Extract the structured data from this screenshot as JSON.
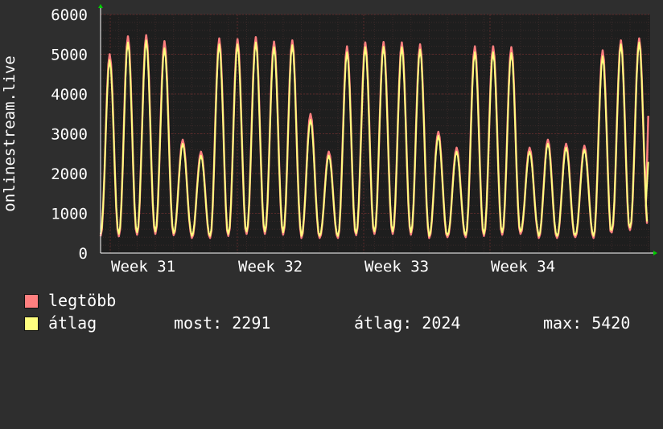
{
  "chart_data": {
    "type": "line",
    "ylabel": "onlinestream.live",
    "yticks": [
      0,
      1000,
      2000,
      3000,
      4000,
      5000,
      6000
    ],
    "ylim": [
      0,
      6000
    ],
    "xlabels": [
      "Week 31",
      "Week 32",
      "Week 33",
      "Week 34"
    ],
    "grid": true,
    "series": [
      {
        "name": "legtöbb",
        "color": "#ff7f7f",
        "peaks": [
          5000,
          5450,
          5480,
          5330,
          2850,
          2550,
          5400,
          5380,
          5430,
          5320,
          5350,
          3500,
          2550,
          5200,
          5300,
          5310,
          5300,
          5250,
          3050,
          2650,
          5200,
          5200,
          5180,
          2650,
          2850,
          2750,
          2700,
          5100,
          5350,
          5400
        ],
        "troughs": [
          420,
          420,
          460,
          480,
          450,
          380,
          380,
          430,
          480,
          480,
          460,
          380,
          380,
          380,
          450,
          480,
          480,
          460,
          380,
          400,
          400,
          430,
          460,
          480,
          380,
          380,
          400,
          380,
          520,
          580
        ],
        "last": 3450
      },
      {
        "name": "átlag",
        "color": "#ffff7f",
        "peaks": [
          4850,
          5300,
          5350,
          5150,
          2750,
          2450,
          5250,
          5250,
          5300,
          5180,
          5230,
          3350,
          2450,
          5050,
          5180,
          5190,
          5180,
          5120,
          2950,
          2550,
          5050,
          5050,
          5030,
          2550,
          2750,
          2650,
          2600,
          4950,
          5250,
          5300
        ],
        "troughs": [
          480,
          480,
          520,
          540,
          500,
          430,
          430,
          480,
          540,
          540,
          520,
          430,
          430,
          430,
          500,
          540,
          540,
          520,
          430,
          450,
          450,
          480,
          520,
          540,
          430,
          430,
          450,
          430,
          580,
          640
        ],
        "last": 2291
      }
    ]
  },
  "legend": [
    {
      "label": "legtöbb",
      "color": "#ff7f7f"
    },
    {
      "label": "átlag",
      "color": "#ffff7f"
    }
  ],
  "stats": {
    "now": "most: 2291",
    "avg": "átlag: 2024",
    "max": "max: 5420"
  },
  "colors": {
    "background": "#2e2e2e",
    "plot_background": "#1e1e1e",
    "grid": "#5a2a2a",
    "axis": "#ffffff",
    "arrow": "#00cc00"
  }
}
